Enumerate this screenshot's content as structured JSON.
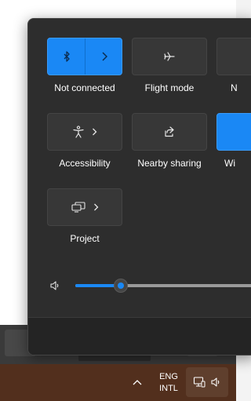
{
  "quick_settings": {
    "tiles": [
      {
        "label": "Not connected",
        "state": "on",
        "icon": "bluetooth-icon"
      },
      {
        "label": "Flight mode",
        "state": "off",
        "icon": "airplane-icon"
      },
      {
        "label": "N",
        "state": "off",
        "icon": ""
      },
      {
        "label": "Accessibility",
        "state": "off",
        "icon": "accessibility-icon"
      },
      {
        "label": "Nearby sharing",
        "state": "off",
        "icon": "share-icon"
      },
      {
        "label": "Wi",
        "state": "on",
        "icon": ""
      },
      {
        "label": "Project",
        "state": "off",
        "icon": "project-icon"
      }
    ],
    "volume": {
      "level_fraction": 0.24,
      "icon": "speaker-icon"
    }
  },
  "taskbar": {
    "language_line1": "ENG",
    "language_line2": "INTL",
    "tray_icons": [
      "network-icon",
      "speaker-icon"
    ],
    "overflow_icon": "chevron-up-icon"
  },
  "colors": {
    "accent": "#1a88f5",
    "panel": "#2d2d2d",
    "tile_off": "#373737",
    "taskbar": "#522f1d"
  }
}
